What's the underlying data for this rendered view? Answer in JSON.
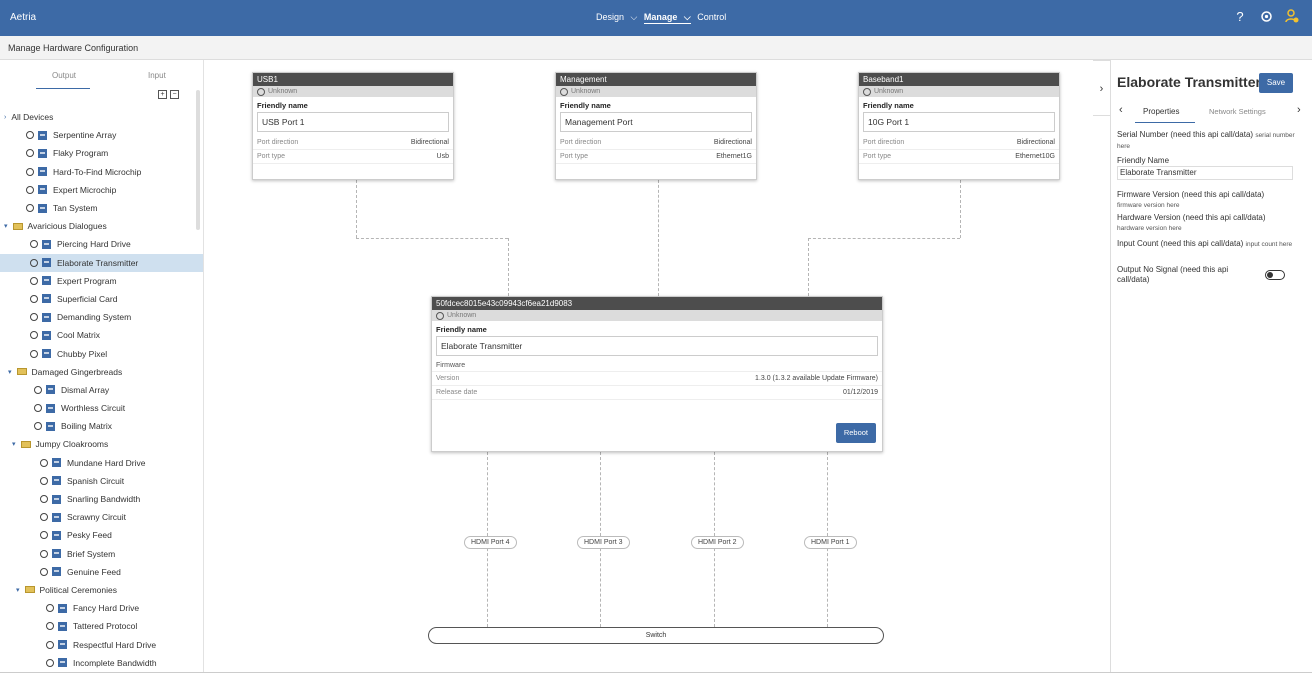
{
  "topbar": {
    "app_name": "Aetria",
    "nav": [
      "Design",
      "Manage",
      "Control"
    ],
    "help": "?",
    "settings": "gear-icon",
    "user": "user-icon"
  },
  "subbar": {
    "title": "Manage Hardware Configuration"
  },
  "left": {
    "tab_output": "Output",
    "tab_input": "Input",
    "expand": "+",
    "collapse": "−",
    "all_devices": "All Devices",
    "groups": [
      {
        "name": "",
        "items": [
          "Serpentine Array",
          "Flaky Program",
          "Hard-To-Find Microchip",
          "Expert Microchip",
          "Tan System"
        ]
      },
      {
        "name": "Avaricious Dialogues",
        "items": [
          "Piercing Hard Drive",
          "Elaborate Transmitter",
          "Expert Program",
          "Superficial Card",
          "Demanding System",
          "Cool Matrix",
          "Chubby Pixel"
        ]
      },
      {
        "name": "Damaged Gingerbreads",
        "items": [
          "Dismal Array",
          "Worthless Circuit",
          "Boiling Matrix"
        ]
      },
      {
        "name": "Jumpy Cloakrooms",
        "items": [
          "Mundane Hard Drive",
          "Spanish Circuit",
          "Snarling Bandwidth",
          "Scrawny Circuit",
          "Pesky Feed",
          "Brief System",
          "Genuine Feed"
        ]
      },
      {
        "name": "Political Ceremonies",
        "items": [
          "Fancy Hard Drive",
          "Tattered Protocol",
          "Respectful Hard Drive",
          "Incomplete Bandwidth"
        ]
      }
    ]
  },
  "cards": [
    {
      "title": "USB1",
      "status": "Unknown",
      "fname_label": "Friendly name",
      "fname": "USB Port 1",
      "dir_label": "Port direction",
      "dir": "Bidirectional",
      "type_label": "Port type",
      "type": "Usb"
    },
    {
      "title": "Management",
      "status": "Unknown",
      "fname_label": "Friendly name",
      "fname": "Management Port",
      "dir_label": "Port direction",
      "dir": "Bidirectional",
      "type_label": "Port type",
      "type": "Ethernet1G"
    },
    {
      "title": "Baseband1",
      "status": "Unknown",
      "fname_label": "Friendly name",
      "fname": "10G Port 1",
      "dir_label": "Port direction",
      "dir": "Bidirectional",
      "type_label": "Port type",
      "type": "Ethernet10G"
    }
  ],
  "main": {
    "title": "50fdcec8015e43c09943cf6ea21d9083",
    "status": "Unknown",
    "fname_label": "Friendly name",
    "fname": "Elaborate Transmitter",
    "fw_label": "Firmware",
    "ver_label": "Version",
    "ver": "1.3.0 (1.3.2 available Update Firmware)",
    "rel_label": "Release date",
    "rel": "01/12/2019",
    "reboot": "Reboot"
  },
  "ports": [
    "HDMI Port 4",
    "HDMI Port 3",
    "HDMI Port 2",
    "HDMI Port 1"
  ],
  "switch_label": "Switch",
  "right": {
    "title": "Elaborate Transmitter",
    "save": "Save",
    "tab1": "Properties",
    "tab2": "Network Settings",
    "serial_label": "Serial Number (need this api call/data)",
    "serial_val": "serial number here",
    "fname_label": "Friendly Name",
    "fname": "Elaborate Transmitter",
    "fw_label": "Firmware Version (need this api call/data)",
    "fw_val": "firmware version here",
    "hw_label": "Hardware Version (need this api call/data)",
    "hw_val": "hardware version here",
    "ic_label": "Input Count (need this api call/data)",
    "ic_val": "input count here",
    "ons_label": "Output No Signal (need this api call/data)"
  }
}
